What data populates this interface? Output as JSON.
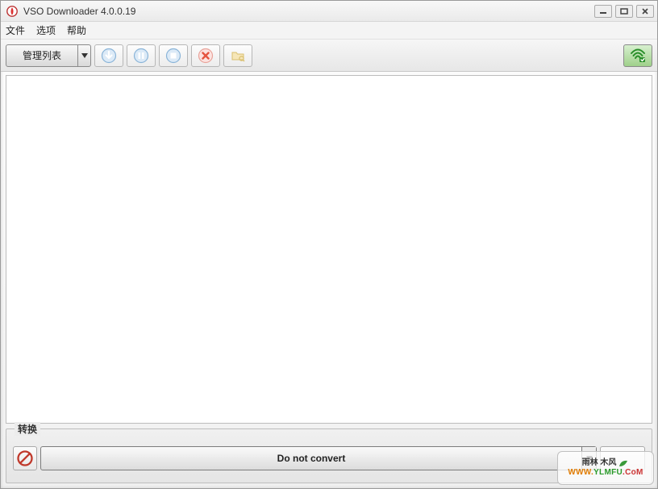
{
  "window": {
    "title": "VSO Downloader 4.0.0.19"
  },
  "menu": {
    "file": "文件",
    "options": "选项",
    "help": "帮助"
  },
  "toolbar": {
    "manage_list": "管理列表"
  },
  "convert": {
    "caption": "转换",
    "selected": "Do not convert"
  },
  "watermark": {
    "brand_cn": "雨林 木风",
    "url_www": "WWW.",
    "url_domain": "YLMFU",
    "url_tld": ".CoM"
  }
}
